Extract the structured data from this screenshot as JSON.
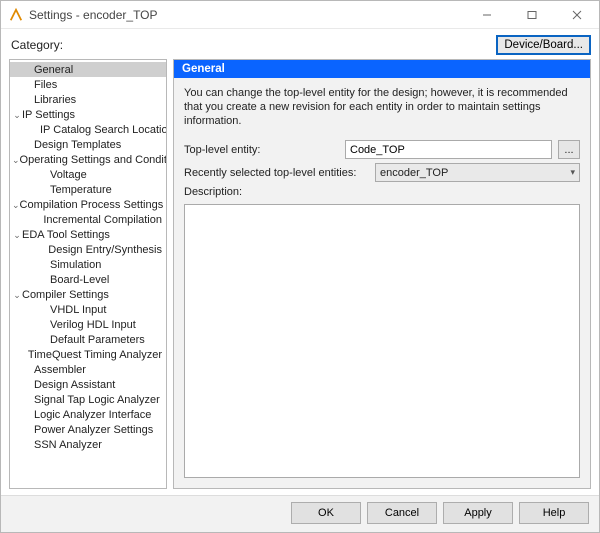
{
  "window": {
    "title": "Settings - encoder_TOP"
  },
  "toprow": {
    "category_label": "Category:",
    "device_button": "Device/Board..."
  },
  "tree": [
    {
      "label": "General",
      "depth": 1,
      "caret": "",
      "selected": true,
      "name": "tree-general"
    },
    {
      "label": "Files",
      "depth": 1,
      "caret": "",
      "name": "tree-files"
    },
    {
      "label": "Libraries",
      "depth": 1,
      "caret": "",
      "name": "tree-libraries"
    },
    {
      "label": "IP Settings",
      "depth": 0,
      "caret": "⌄",
      "name": "tree-ip-settings"
    },
    {
      "label": "IP Catalog Search Locations",
      "depth": 2,
      "caret": "",
      "name": "tree-ip-catalog"
    },
    {
      "label": "Design Templates",
      "depth": 1,
      "caret": "",
      "name": "tree-design-templates"
    },
    {
      "label": "Operating Settings and Conditions",
      "depth": 0,
      "caret": "⌄",
      "name": "tree-operating"
    },
    {
      "label": "Voltage",
      "depth": 2,
      "caret": "",
      "name": "tree-voltage"
    },
    {
      "label": "Temperature",
      "depth": 2,
      "caret": "",
      "name": "tree-temperature"
    },
    {
      "label": "Compilation Process Settings",
      "depth": 0,
      "caret": "⌄",
      "name": "tree-compilation"
    },
    {
      "label": "Incremental Compilation",
      "depth": 2,
      "caret": "",
      "name": "tree-incremental"
    },
    {
      "label": "EDA Tool Settings",
      "depth": 0,
      "caret": "⌄",
      "name": "tree-eda"
    },
    {
      "label": "Design Entry/Synthesis",
      "depth": 2,
      "caret": "",
      "name": "tree-design-entry"
    },
    {
      "label": "Simulation",
      "depth": 2,
      "caret": "",
      "name": "tree-simulation"
    },
    {
      "label": "Board-Level",
      "depth": 2,
      "caret": "",
      "name": "tree-board-level"
    },
    {
      "label": "Compiler Settings",
      "depth": 0,
      "caret": "⌄",
      "name": "tree-compiler"
    },
    {
      "label": "VHDL Input",
      "depth": 2,
      "caret": "",
      "name": "tree-vhdl"
    },
    {
      "label": "Verilog HDL Input",
      "depth": 2,
      "caret": "",
      "name": "tree-verilog"
    },
    {
      "label": "Default Parameters",
      "depth": 2,
      "caret": "",
      "name": "tree-default-params"
    },
    {
      "label": "TimeQuest Timing Analyzer",
      "depth": 1,
      "caret": "",
      "name": "tree-timequest"
    },
    {
      "label": "Assembler",
      "depth": 1,
      "caret": "",
      "name": "tree-assembler"
    },
    {
      "label": "Design Assistant",
      "depth": 1,
      "caret": "",
      "name": "tree-design-assistant"
    },
    {
      "label": "Signal Tap Logic Analyzer",
      "depth": 1,
      "caret": "",
      "name": "tree-signaltap"
    },
    {
      "label": "Logic Analyzer Interface",
      "depth": 1,
      "caret": "",
      "name": "tree-lai"
    },
    {
      "label": "Power Analyzer Settings",
      "depth": 1,
      "caret": "",
      "name": "tree-power"
    },
    {
      "label": "SSN Analyzer",
      "depth": 1,
      "caret": "",
      "name": "tree-ssn"
    }
  ],
  "panel": {
    "header": "General",
    "helptext": "You can change the top-level entity for the design; however, it is recommended that you create a new revision for each entity in order to maintain settings information.",
    "top_entity_label": "Top-level entity:",
    "top_entity_value": "Code_TOP",
    "browse_dots": "...",
    "recent_label": "Recently selected top-level entities:",
    "recent_value": "encoder_TOP",
    "description_label": "Description:"
  },
  "buttons": {
    "ok": "OK",
    "cancel": "Cancel",
    "apply": "Apply",
    "help": "Help"
  }
}
